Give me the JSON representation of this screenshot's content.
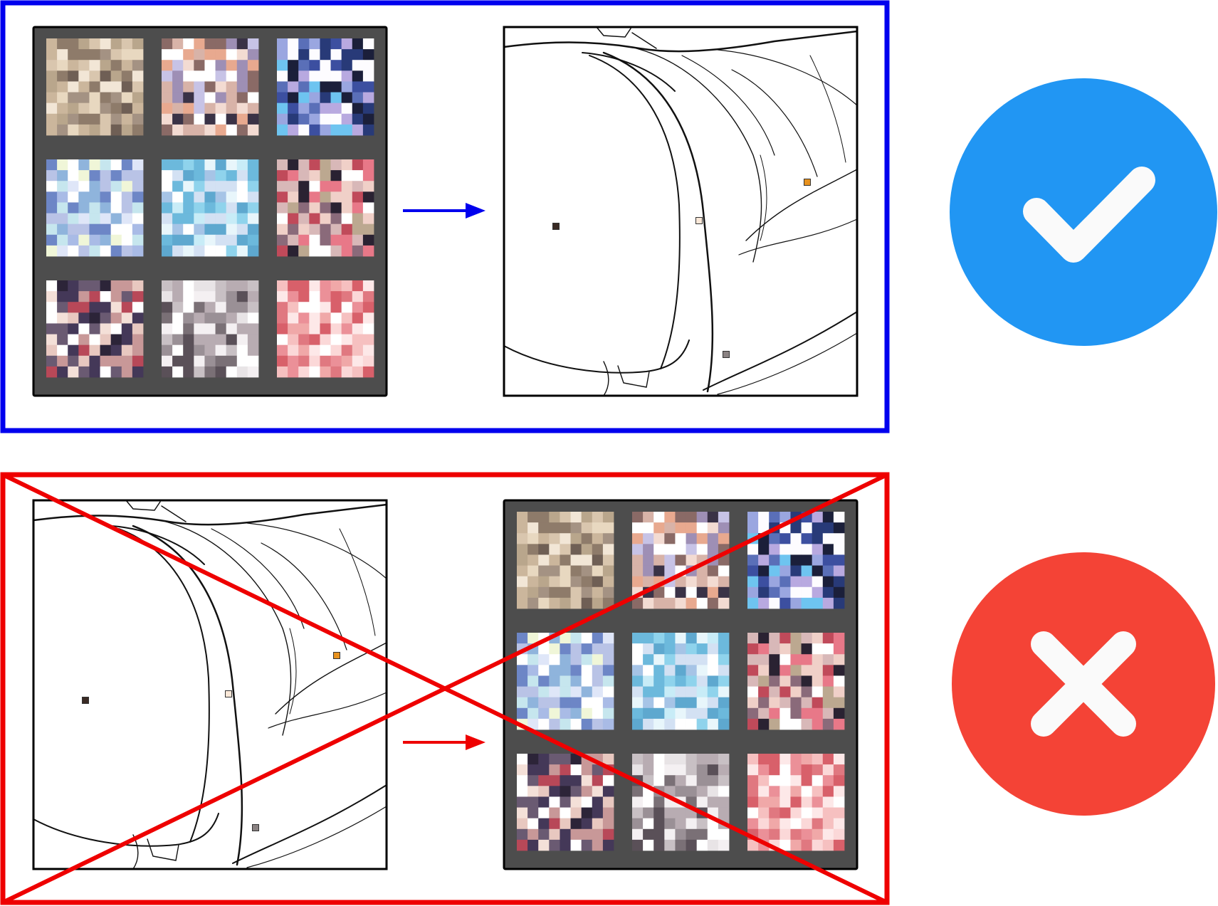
{
  "colors": {
    "correct_frame": "#0000ee",
    "wrong_frame": "#ee0000",
    "palette_bg": "#4d4d4d",
    "check_circle": "#2196f3",
    "cross_circle": "#f44336",
    "mark_stroke": "#fafafa"
  },
  "panels": {
    "correct": {
      "order": [
        "palette-grid",
        "line-art"
      ],
      "badge_icon": "checkmark-icon",
      "arrow_color": "#0000ee"
    },
    "wrong": {
      "order": [
        "line-art",
        "palette-grid"
      ],
      "badge_icon": "cross-icon",
      "arrow_color": "#ee0000",
      "crossed_out": true
    }
  },
  "palettes": [
    {
      "tone": "beige",
      "colors": [
        "#b9a68c",
        "#cbb69c",
        "#8e7b6a",
        "#e8d8c0",
        "#a49283",
        "#d9c6ae",
        "#f2e6d6",
        "#6f5f55"
      ]
    },
    {
      "tone": "mixed",
      "colors": [
        "#d8b3a8",
        "#f3dbd2",
        "#8a6a66",
        "#c7c3e6",
        "#3a3246",
        "#e8a98f",
        "#ffffff",
        "#9e8fb5"
      ]
    },
    {
      "tone": "blue",
      "colors": [
        "#283a78",
        "#5a6fb8",
        "#9aa6e0",
        "#1b1f3a",
        "#6ec4f0",
        "#b8a9e0",
        "#fdfcff",
        "#3c4fa0"
      ]
    },
    {
      "tone": "pale-blue",
      "colors": [
        "#a9bbe6",
        "#dfe6f8",
        "#6d86c6",
        "#c6e6ee",
        "#ffffff",
        "#f0f6d8",
        "#8fb4dc",
        "#b9c3e6"
      ]
    },
    {
      "tone": "cyan",
      "colors": [
        "#8fd3ec",
        "#c8ecf7",
        "#e8f6fb",
        "#6cb9dc",
        "#ffffff",
        "#a6c4e6",
        "#d3e1f3",
        "#5ea8cf"
      ]
    },
    {
      "tone": "red-mix",
      "colors": [
        "#c04a5a",
        "#f0d0c8",
        "#2a2232",
        "#d8b8b8",
        "#8a6a7a",
        "#ffffff",
        "#e87888",
        "#bca890"
      ]
    },
    {
      "tone": "dark-mix",
      "colors": [
        "#2c2438",
        "#e8c8c0",
        "#b84858",
        "#ffffff",
        "#6a5a72",
        "#f4e0d8",
        "#443858",
        "#c89898"
      ]
    },
    {
      "tone": "gray",
      "colors": [
        "#9a9096",
        "#e8e4e6",
        "#ffffff",
        "#5a5058",
        "#c8c0c4",
        "#f4f0f2",
        "#b8acb2",
        "#7a7076"
      ]
    },
    {
      "tone": "pink",
      "colors": [
        "#f0a8a8",
        "#fbd8d8",
        "#e07880",
        "#ffffff",
        "#f6c0c0",
        "#d8606a",
        "#fde8e8",
        "#eb9098"
      ]
    }
  ],
  "sample_points": [
    {
      "color": "#3a2a24"
    },
    {
      "color": "#fbe8d8"
    },
    {
      "color": "#e8921e"
    },
    {
      "color": "#8a8282"
    }
  ]
}
